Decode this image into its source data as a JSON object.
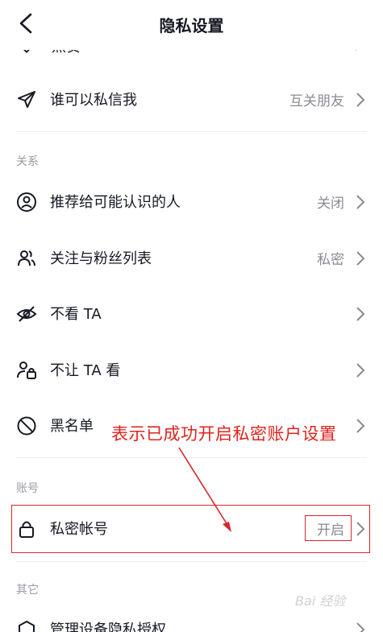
{
  "header": {
    "title": "隐私设置"
  },
  "cut_item": {
    "label": "点赞"
  },
  "rows": {
    "dm": {
      "label": "谁可以私信我",
      "value": "互关朋友"
    },
    "recommend": {
      "label": "推荐给可能认识的人",
      "value": "关闭"
    },
    "follow_list": {
      "label": "关注与粉丝列表",
      "value": "私密"
    },
    "not_see": {
      "label": "不看 TA"
    },
    "not_let_see": {
      "label": "不让 TA 看"
    },
    "blacklist": {
      "label": "黑名单"
    },
    "private_account": {
      "label": "私密帐号",
      "value": "开启"
    },
    "device_privacy": {
      "label": "管理设备隐私授权"
    }
  },
  "sections": {
    "relations": "关系",
    "account": "账号",
    "other": "其它"
  },
  "annotation": {
    "text": "表示已成功开启私密账户设置",
    "color": "#e0231c"
  },
  "watermark": {
    "text": "Bai 经验"
  },
  "icons": {
    "back": "back-arrow-icon",
    "send": "paper-plane-icon",
    "person": "person-circle-icon",
    "people": "people-icon",
    "eye_off": "eye-off-icon",
    "person_lock": "person-lock-icon",
    "block": "block-icon",
    "lock": "lock-icon",
    "chevron": "chevron-right-icon"
  }
}
